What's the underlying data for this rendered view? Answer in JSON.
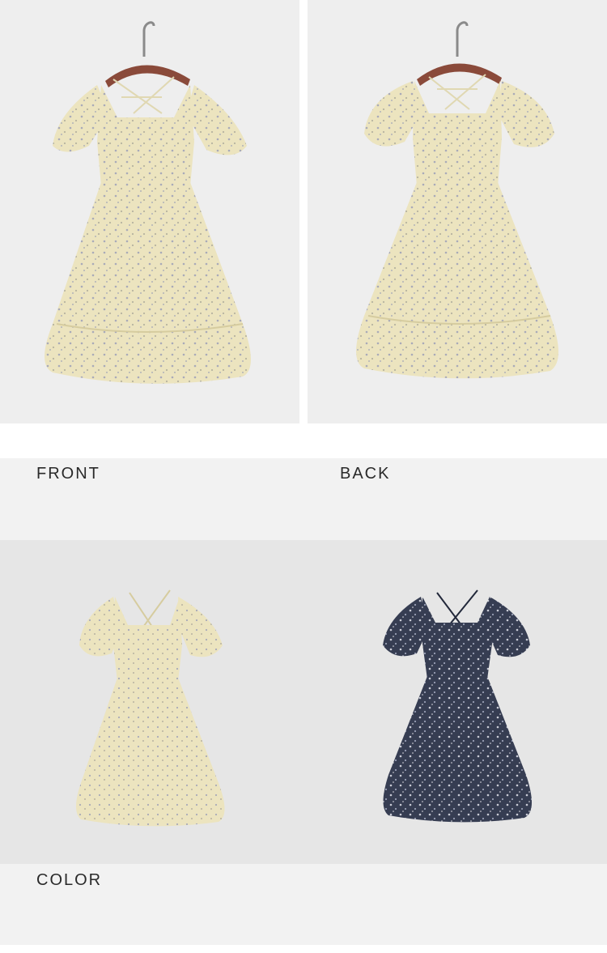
{
  "views": {
    "front_label": "FRONT",
    "back_label": "BACK"
  },
  "colors_section": {
    "label": "COLOR"
  },
  "palette": {
    "cream": "#ece4bf",
    "cream_shadow": "#d6cc9f",
    "navy": "#363d52",
    "navy_shadow": "#22283a",
    "hanger_wood": "#8a4a3a",
    "hanger_metal": "#8a8a8a",
    "background": "#eeeeee"
  }
}
